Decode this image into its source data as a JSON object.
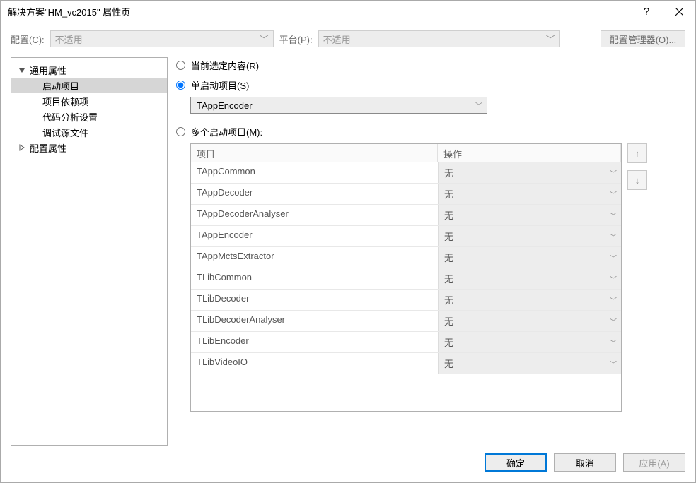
{
  "window": {
    "title": "解决方案\"HM_vc2015\" 属性页",
    "help": "?",
    "close": "×"
  },
  "toolbar": {
    "config_label": "配置(C):",
    "config_value": "不适用",
    "platform_label": "平台(P):",
    "platform_value": "不适用",
    "config_manager": "配置管理器(O)..."
  },
  "tree": {
    "root1": "通用属性",
    "items": [
      "启动项目",
      "项目依赖项",
      "代码分析设置",
      "调试源文件"
    ],
    "root2": "配置属性",
    "selected_index": 0
  },
  "radios": {
    "current": "当前选定内容(R)",
    "single": "单启动项目(S)",
    "multi": "多个启动项目(M):",
    "selected": "single"
  },
  "single_dropdown": {
    "value": "TAppEncoder"
  },
  "table": {
    "header_project": "项目",
    "header_action": "操作",
    "default_action": "无",
    "rows": [
      {
        "project": "TAppCommon",
        "action": "无"
      },
      {
        "project": "TAppDecoder",
        "action": "无"
      },
      {
        "project": "TAppDecoderAnalyser",
        "action": "无"
      },
      {
        "project": "TAppEncoder",
        "action": "无"
      },
      {
        "project": "TAppMctsExtractor",
        "action": "无"
      },
      {
        "project": "TLibCommon",
        "action": "无"
      },
      {
        "project": "TLibDecoder",
        "action": "无"
      },
      {
        "project": "TLibDecoderAnalyser",
        "action": "无"
      },
      {
        "project": "TLibEncoder",
        "action": "无"
      },
      {
        "project": "TLibVideoIO",
        "action": "无"
      }
    ]
  },
  "buttons": {
    "ok": "确定",
    "cancel": "取消",
    "apply": "应用(A)"
  }
}
